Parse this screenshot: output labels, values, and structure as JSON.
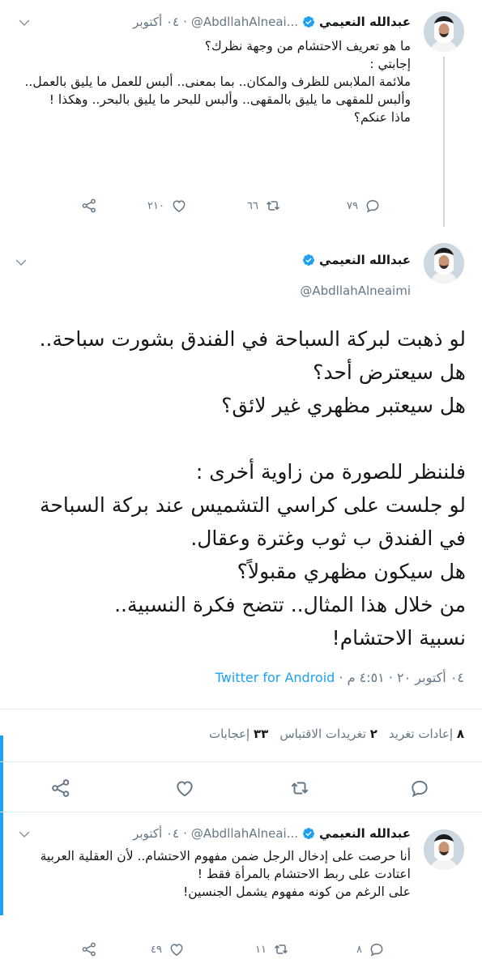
{
  "tweet1": {
    "name": "عبدالله النعيمي",
    "handle": "@AbdllahAlneai...",
    "date": "٠٤ أكتوبر",
    "text": "ما هو تعريف الاحتشام من وجهة نظرك؟\nإجابتي :\nملائمة الملابس للظرف والمكان.. بما بمعنى.. ألبس للعمل ما يليق بالعمل.. وألبس للمقهى ما يليق بالمقهى.. وألبس للبحر ما يليق بالبحر.. وهكذا !\nماذا عنكم؟",
    "replies": "٧٩",
    "retweets": "٦٦",
    "likes": "٢١٠"
  },
  "tweet2": {
    "name": "عبدالله النعيمي",
    "handle": "@AbdllahAlneaimi",
    "text": "لو ذهبت لبركة السباحة في الفندق بشورت سباحة.. هل سيعترض أحد؟\nهل سيعتبر مظهري غير لائق؟\n\nفلننظر للصورة من زاوية أخرى :\nلو جلست على كراسي التشميس عند بركة السباحة في الفندق ب ثوب وغترة وعقال.\nهل سيكون مظهري مقبولاً؟\nمن خلال هذا المثال.. تتضح فكرة النسبية..\nنسبية الاحتشام!",
    "time": "٤:٥١ م",
    "date": "٠٤ أكتوبر ٢٠",
    "source": "Twitter for Android",
    "stats": {
      "retweets_num": "٨",
      "retweets_label": "إعادات تغريد",
      "quotes_num": "٢",
      "quotes_label": "تغريدات الاقتباس",
      "likes_num": "٣٣",
      "likes_label": "إعجابات"
    }
  },
  "tweet3": {
    "name": "عبدالله النعيمي",
    "handle": "@AbdllahAlneai...",
    "date": "٠٤ أكتوبر",
    "text": "أنا حرصت على إدخال الرجل ضمن مفهوم الاحتشام.. لأن العقلية العربية اعتادت على ربط الاحتشام بالمرأة فقط !\nعلى الرغم من كونه مفهوم يشمل الجنسين!",
    "replies": "٨",
    "retweets": "١١",
    "likes": "٤٩"
  },
  "colors": {
    "accent": "#1da1f2",
    "muted": "#657786",
    "divider": "#e1e8ed"
  }
}
